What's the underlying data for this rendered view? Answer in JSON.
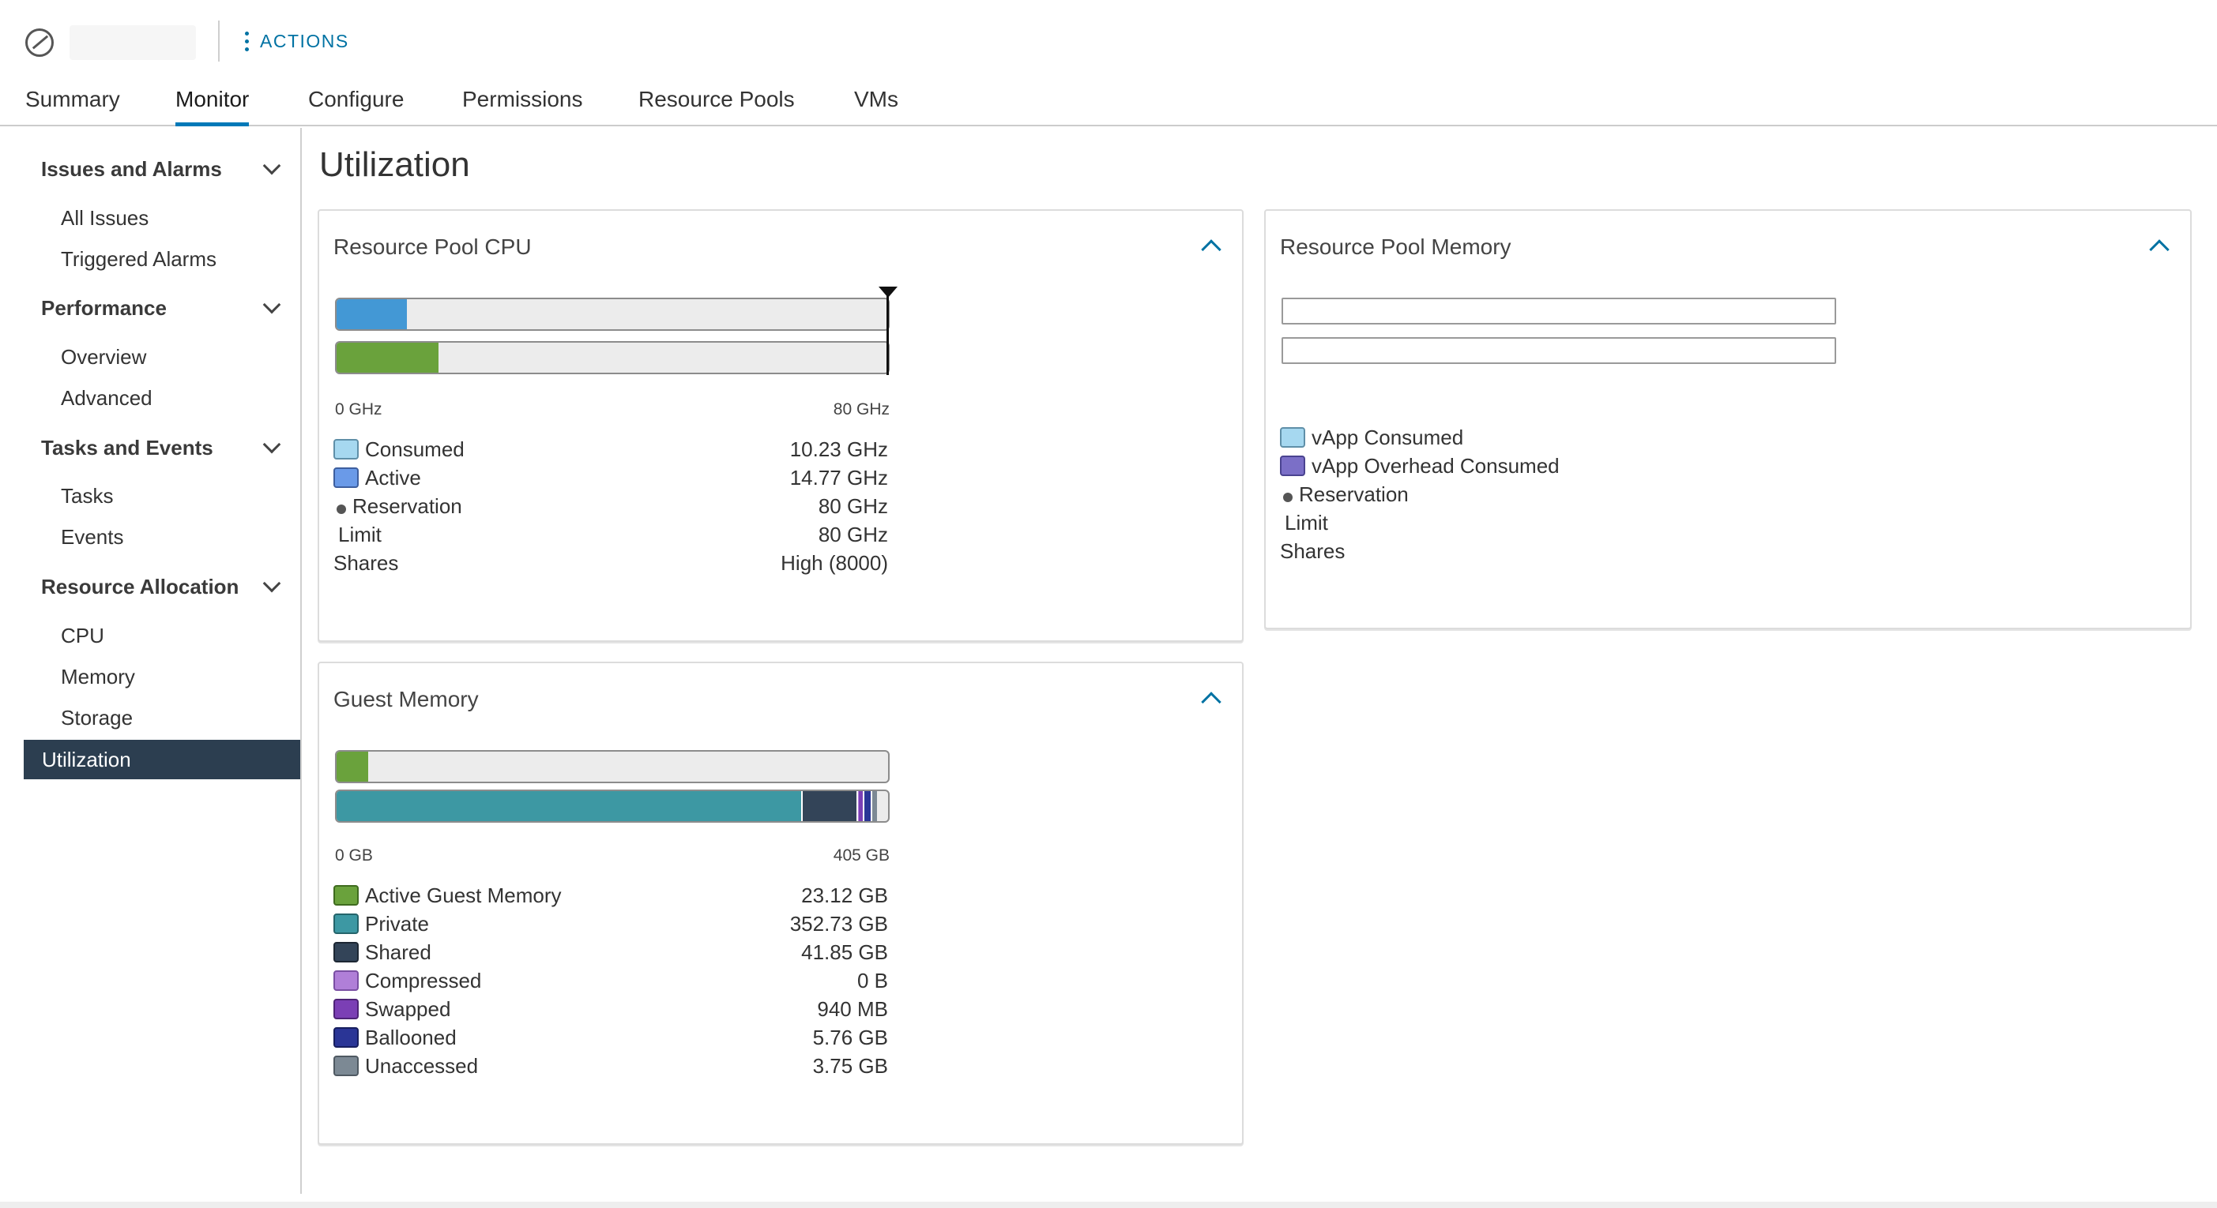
{
  "header": {
    "actions_label": "ACTIONS"
  },
  "tabs": [
    {
      "label": "Summary"
    },
    {
      "label": "Monitor",
      "active": true
    },
    {
      "label": "Configure"
    },
    {
      "label": "Permissions"
    },
    {
      "label": "Resource Pools"
    },
    {
      "label": "VMs"
    }
  ],
  "sidebar": {
    "groups": [
      {
        "label": "Issues and Alarms",
        "items": [
          "All Issues",
          "Triggered Alarms"
        ]
      },
      {
        "label": "Performance",
        "items": [
          "Overview",
          "Advanced"
        ]
      },
      {
        "label": "Tasks and Events",
        "items": [
          "Tasks",
          "Events"
        ]
      },
      {
        "label": "Resource Allocation",
        "items": [
          "CPU",
          "Memory",
          "Storage"
        ]
      }
    ],
    "selected": "Utilization"
  },
  "page": {
    "title": "Utilization"
  },
  "cpu_card": {
    "title": "Resource Pool CPU",
    "axis_min": "0 GHz",
    "axis_max": "80 GHz",
    "bars": {
      "consumed_fraction": 0.128,
      "active_fraction": 0.185
    },
    "legend": [
      {
        "label": "Consumed",
        "value": "10.23 GHz",
        "color": "#a6d8f0"
      },
      {
        "label": "Active",
        "value": "14.77 GHz",
        "color": "#6a9ae8"
      },
      {
        "label": "Reservation",
        "value": "80 GHz"
      },
      {
        "label": "Limit",
        "value": "80 GHz"
      },
      {
        "label": "Shares",
        "value": "High (8000)"
      }
    ]
  },
  "memory_card": {
    "title": "Resource Pool Memory",
    "legend": [
      {
        "label": "vApp Consumed",
        "color": "#a6d8f0"
      },
      {
        "label": "vApp Overhead Consumed",
        "color": "#7b6fc7"
      },
      {
        "label": "Reservation"
      },
      {
        "label": "Limit"
      },
      {
        "label": "Shares"
      }
    ]
  },
  "guest_card": {
    "title": "Guest Memory",
    "axis_min": "0 GB",
    "axis_max": "405 GB",
    "bars": {
      "active_fraction": 0.057,
      "breakdown_fractions": {
        "private": 0.845,
        "shared": 0.1,
        "compressed": 0.002,
        "swapped": 0.01,
        "ballooned": 0.014,
        "unaccessed": 0.009
      }
    },
    "legend": [
      {
        "label": "Active Guest Memory",
        "value": "23.12 GB",
        "color": "#6aa23c"
      },
      {
        "label": "Private",
        "value": "352.73 GB",
        "color": "#3d98a3"
      },
      {
        "label": "Shared",
        "value": "41.85 GB",
        "color": "#334458"
      },
      {
        "label": "Compressed",
        "value": "0 B",
        "color": "#b07fd8"
      },
      {
        "label": "Swapped",
        "value": "940 MB",
        "color": "#7b3fb5"
      },
      {
        "label": "Ballooned",
        "value": "5.76 GB",
        "color": "#2a3596"
      },
      {
        "label": "Unaccessed",
        "value": "3.75 GB",
        "color": "#7c8994"
      }
    ]
  },
  "colors": {
    "accent": "#0079b8",
    "selected_nav": "#2c3e50",
    "cpu_consumed_bar": "#4398d5",
    "cpu_active_bar": "#6aa23c"
  }
}
